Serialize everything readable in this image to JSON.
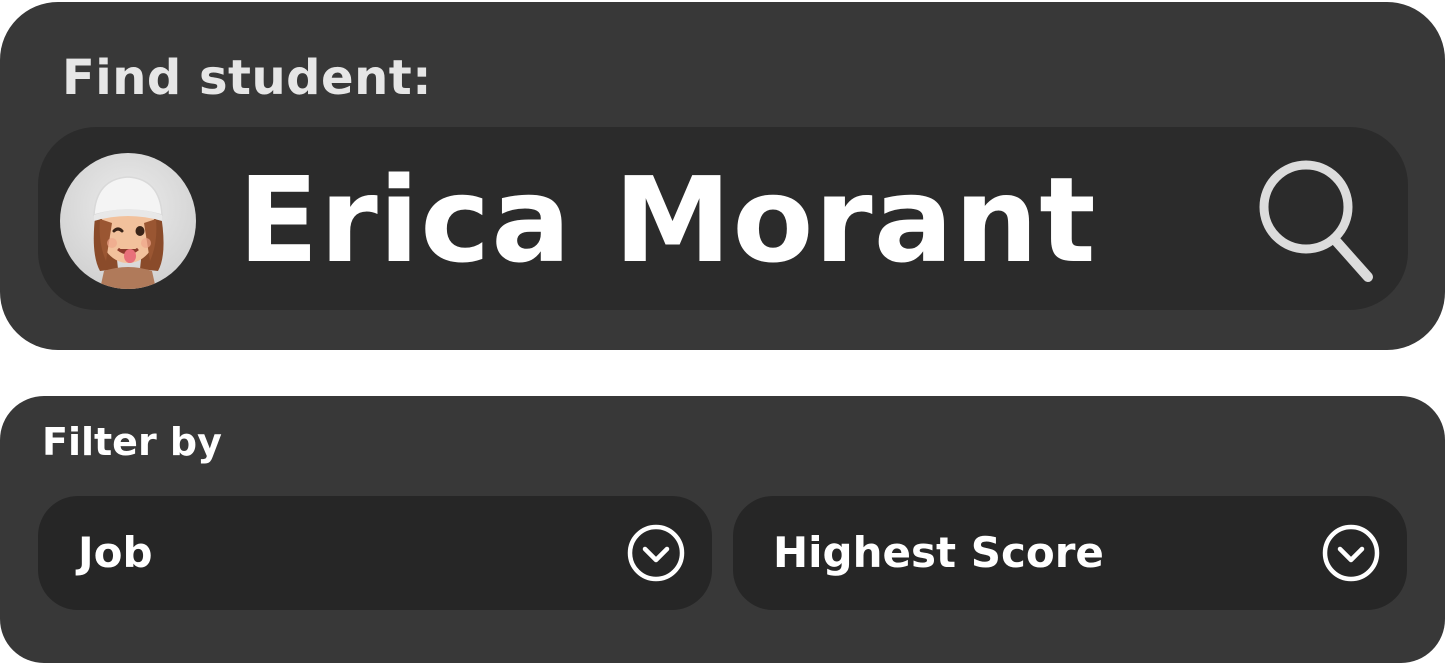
{
  "find": {
    "title": "Find student:",
    "search_value": "Erica Morant",
    "avatar_icon": "memoji-avatar",
    "search_icon": "search-icon"
  },
  "filter": {
    "title": "Filter by",
    "dropdowns": [
      {
        "label": "Job",
        "icon": "chevron-down-circle-icon"
      },
      {
        "label": "Highest Score",
        "icon": "chevron-down-circle-icon"
      }
    ]
  },
  "colors": {
    "panel": "#383838",
    "field": "#2b2b2b",
    "dropdown": "#262626",
    "text": "#ffffff",
    "muted_text": "#e6e6e6",
    "icon": "#e0e0e0"
  }
}
